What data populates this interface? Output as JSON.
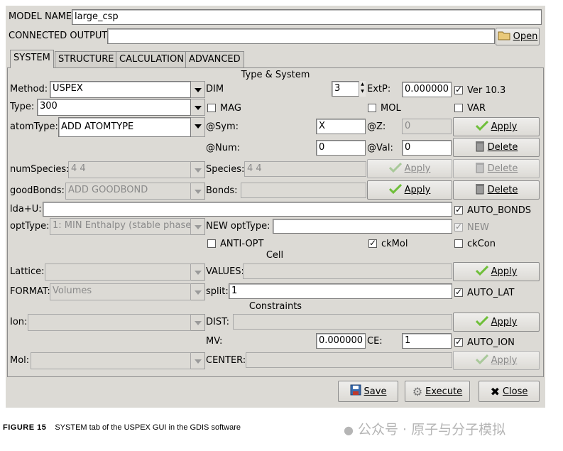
{
  "header": {
    "model_name_label": "MODEL NAME",
    "model_name_value": "large_csp",
    "connected_output_label": "CONNECTED OUTPUT",
    "connected_output_value": "",
    "open_label": "Open"
  },
  "tabs": [
    {
      "label": "SYSTEM",
      "active": true
    },
    {
      "label": "STRUCTURE",
      "active": false
    },
    {
      "label": "CALCULATION",
      "active": false
    },
    {
      "label": "ADVANCED",
      "active": false
    }
  ],
  "sections": {
    "type_system": "Type & System",
    "cell": "Cell",
    "constraints": "Constraints"
  },
  "type_system": {
    "method_label": "Method:",
    "method_value": "USPEX",
    "type_label": "Type:",
    "type_value": "300",
    "atomtype_label": "atomType:",
    "atomtype_value": "ADD ATOMTYPE",
    "dim_label": "DIM",
    "dim_value": "3",
    "extp_label": "ExtP:",
    "extp_value": "0.000000",
    "ver_label": "Ver 10.3",
    "mag_label": "MAG",
    "mol_label": "MOL",
    "var_label": "VAR",
    "sym_label": "@Sym:",
    "sym_value": "X",
    "z_label": "@Z:",
    "z_value": "0",
    "num_label": "@Num:",
    "num_value": "0",
    "val_label": "@Val:",
    "val_value": "0",
    "numspecies_label": "numSpecies:",
    "numspecies_value": "4 4",
    "species_label": "Species:",
    "species_value": "4 4",
    "goodbonds_label": "goodBonds:",
    "goodbonds_value": "ADD GOODBOND",
    "bonds_label": "Bonds:",
    "bonds_value": "",
    "ldau_label": "lda+U:",
    "ldau_value": "",
    "auto_bonds_label": "AUTO_BONDS",
    "opttype_label": "optType:",
    "opttype_value": "1: MIN Enthalpy (stable phase",
    "new_opttype_label": "NEW optType:",
    "new_opttype_value": "",
    "new_label": "NEW",
    "anti_opt_label": "ANTI-OPT",
    "ckmol_label": "ckMol",
    "ckcon_label": "ckCon"
  },
  "cell": {
    "lattice_label": "Lattice:",
    "lattice_value": "",
    "values_label": "VALUES:",
    "values_value": "",
    "format_label": "FORMAT:",
    "format_value": "Volumes",
    "split_label": "split:",
    "split_value": "1",
    "auto_lat_label": "AUTO_LAT"
  },
  "constraints": {
    "ion_label": "Ion:",
    "ion_value": "",
    "dist_label": "DIST:",
    "dist_value": "",
    "mv_label": "MV:",
    "mv_value": "0.000000",
    "ce_label": "CE:",
    "ce_value": "1",
    "auto_ion_label": "AUTO_ION",
    "mol_label": "Mol:",
    "mol_value": "",
    "center_label": "CENTER:",
    "center_value": ""
  },
  "buttons": {
    "apply": "Apply",
    "delete": "Delete",
    "save": "Save",
    "execute": "Execute",
    "close": "Close"
  },
  "caption": {
    "figure": "FIGURE 15",
    "text": "SYSTEM tab of the USPEX GUI in the GDIS software"
  },
  "watermark": "公众号 · 原子与分子模拟",
  "colors": {
    "window_bg": "#dcdad5",
    "apply_icon": "#6fbf3a"
  }
}
